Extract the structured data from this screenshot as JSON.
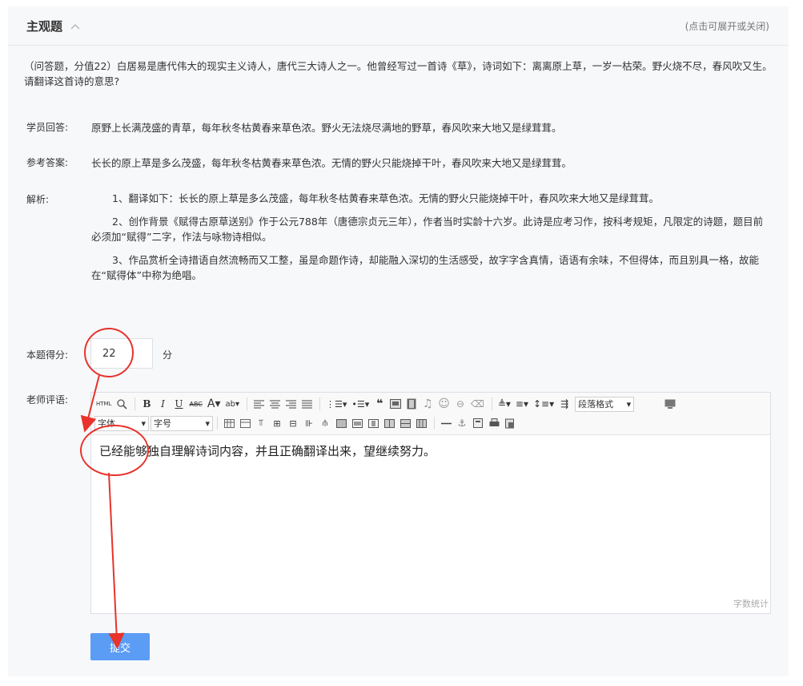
{
  "section": {
    "title": "主观题",
    "toggle_hint": "(点击可展开或关闭)"
  },
  "question": "（问答题，分值22）白居易是唐代伟大的现实主义诗人，唐代三大诗人之一。他曾经写过一首诗《草》，诗词如下：离离原上草，一岁一枯荣。野火烧不尽，春风吹又生。请翻译这首诗的意思?",
  "student_answer": {
    "label": "学员回答:",
    "text": "原野上长满茂盛的青草，每年秋冬枯黄春来草色浓。野火无法烧尽满地的野草，春风吹来大地又是绿茸茸。"
  },
  "reference_answer": {
    "label": "参考答案:",
    "text": "长长的原上草是多么茂盛，每年秋冬枯黄春来草色浓。无情的野火只能烧掉干叶，春风吹来大地又是绿茸茸。"
  },
  "analysis": {
    "label": "解析:",
    "paragraphs": [
      "1、翻译如下：长长的原上草是多么茂盛，每年秋冬枯黄春来草色浓。无情的野火只能烧掉干叶，春风吹来大地又是绿茸茸。",
      "2、创作背景《赋得古原草送别》作于公元788年（唐德宗贞元三年），作者当时实龄十六岁。此诗是应考习作，按科考规矩，凡限定的诗题，题目前必须加“赋得”二字，作法与咏物诗相似。",
      "3、作品赏析全诗措语自然流畅而又工整，虽是命题作诗，却能融入深切的生活感受，故字字含真情，语语有余味，不但得体，而且别具一格，故能在“赋得体”中称为绝唱。"
    ]
  },
  "score": {
    "label": "本题得分:",
    "value": "22",
    "unit": "分"
  },
  "comment": {
    "label": "老师评语:",
    "text": "已经能够独自理解诗词内容，并且正确翻译出来，望继续努力。",
    "word_count": "字数统计"
  },
  "toolbar": {
    "html": "HTML",
    "paragraph_format": "段落格式",
    "font_family": "字体",
    "font_size": "字号"
  },
  "submit_label": "提交",
  "colors": {
    "accent": "#5b9cf5",
    "annotation": "#e8322b"
  }
}
